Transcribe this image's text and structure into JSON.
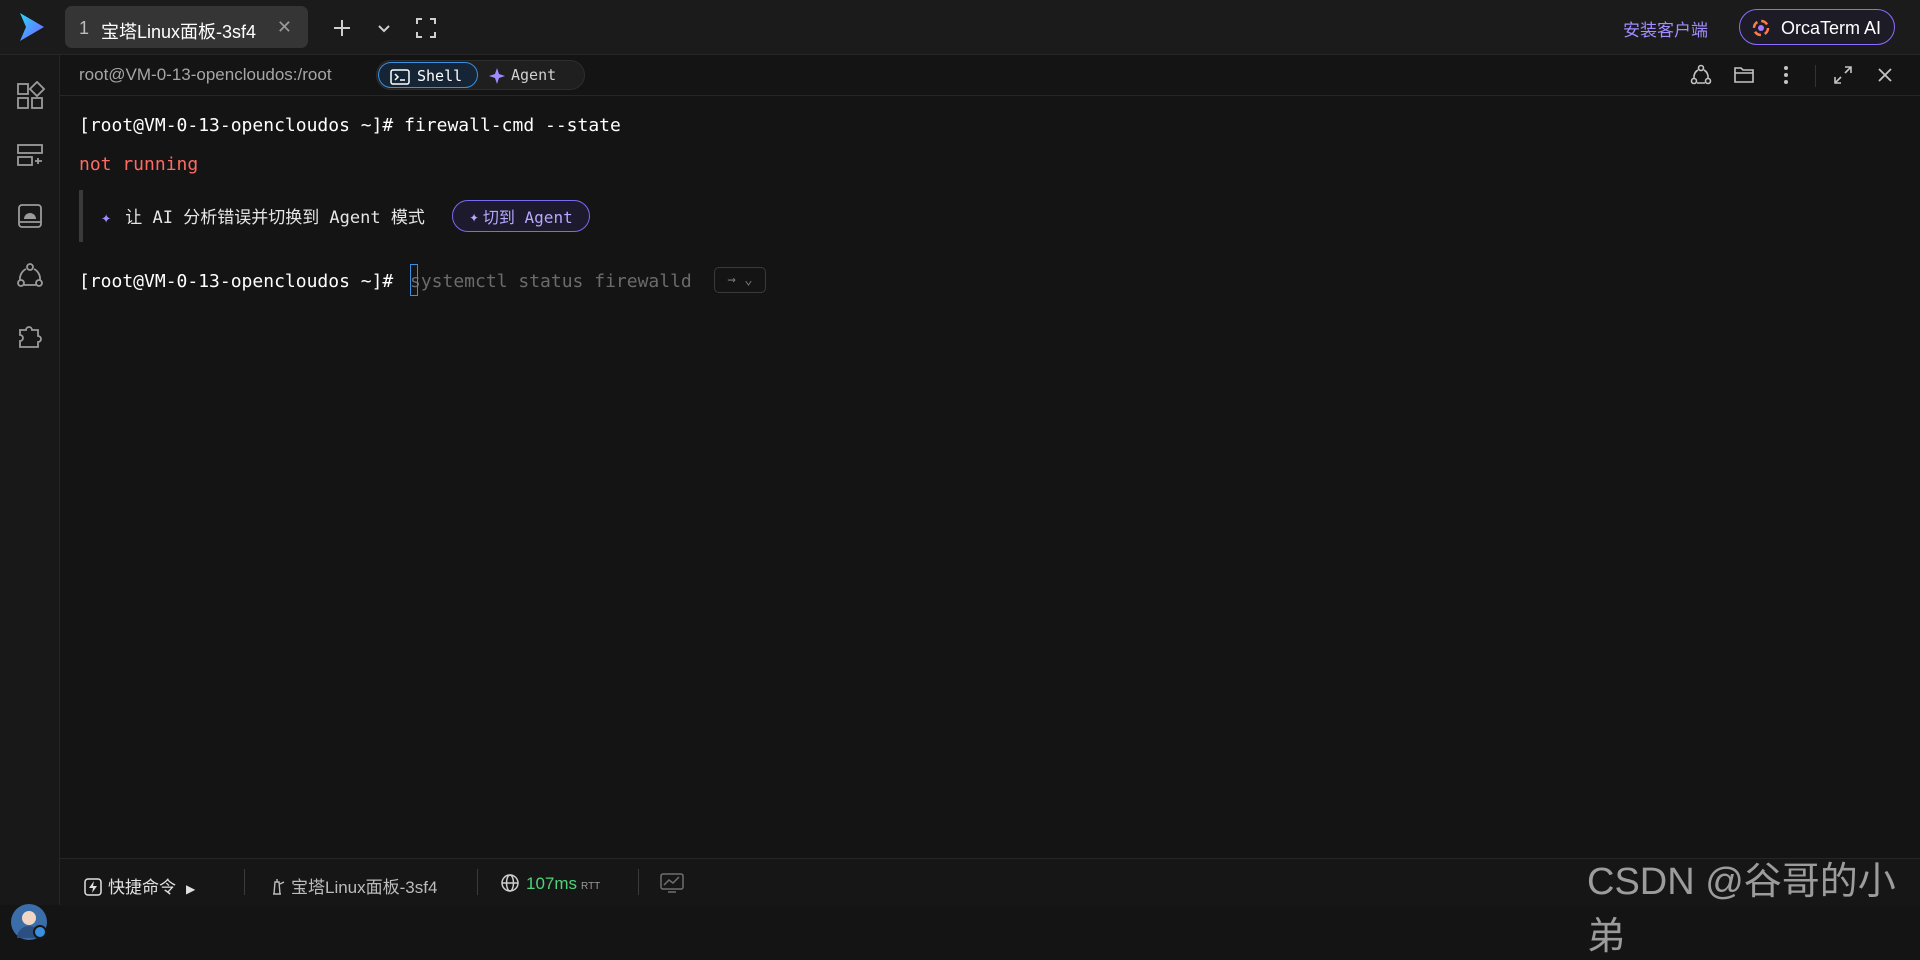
{
  "tab": {
    "number": "1",
    "title": "宝塔Linux面板-3sf4"
  },
  "header_actions": {
    "install_client": "安装客户端",
    "orcaterm_ai": "OrcaTerm AI"
  },
  "subheader": {
    "path": "root@VM-0-13-opencloudos:/root",
    "shell_label": "Shell",
    "agent_label": "Agent"
  },
  "terminal": {
    "line1": "[root@VM-0-13-opencloudos ~]# firewall-cmd --state",
    "line2": "not running",
    "hint_text": "让 AI 分析错误并切换到 Agent 模式",
    "switch_button": "切到 Agent",
    "prompt": "[root@VM-0-13-opencloudos ~]#",
    "suggestion": "systemctl status firewalld",
    "accept_key": "→ ⌄"
  },
  "statusbar": {
    "quick_commands": "快捷命令",
    "server_name": "宝塔Linux面板-3sf4",
    "latency": "107ms",
    "latency_unit": "RTT"
  },
  "watermark": "CSDN @谷哥的小弟",
  "colors": {
    "accent": "#8f6cff",
    "shell_active": "#3b8fe0",
    "error_text": "#ff6b63",
    "latency_good": "#4fd27a"
  }
}
